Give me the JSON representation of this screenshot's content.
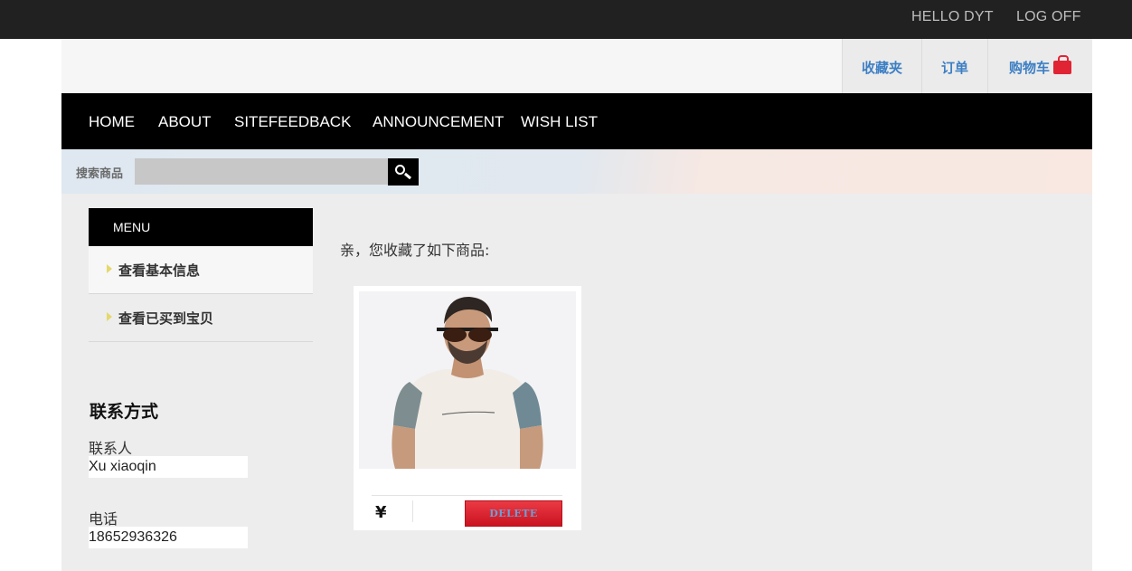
{
  "topbar": {
    "greeting": "HELLO DYT",
    "logoff": "LOG OFF"
  },
  "header_nav": {
    "favorites": "收藏夹",
    "orders": "订单",
    "cart": "购物车"
  },
  "main_nav": [
    "HOME",
    "ABOUT",
    "SITEFEEDBACK",
    "ANNOUNCEMENT",
    "WISH LIST"
  ],
  "search": {
    "label": "搜索商品",
    "value": ""
  },
  "sidebar": {
    "menu_title": "MENU",
    "items": [
      "查看基本信息",
      "查看已买到宝贝"
    ],
    "contact": {
      "title": "联系方式",
      "person_label": "联系人",
      "person_value": "Xu xiaoqin",
      "phone_label": "电话",
      "phone_value": "18652936326"
    }
  },
  "main": {
    "greeting": "亲，您收藏了如下商品:",
    "products": [
      {
        "image_alt": "Man in sunglasses and printed t-shirt",
        "currency": "¥",
        "price": "",
        "delete_label": "DELETE"
      }
    ]
  },
  "colors": {
    "accent_link": "#3d7fc4",
    "topbar_bg": "#212121",
    "nav_bg": "#000000",
    "delete_button": "#d61f2a",
    "cart_icon": "#e02434"
  },
  "icons": {
    "cart": "shopping-bag-icon",
    "search": "magnifier-icon",
    "menu_bullet": "triangle-right-icon"
  }
}
